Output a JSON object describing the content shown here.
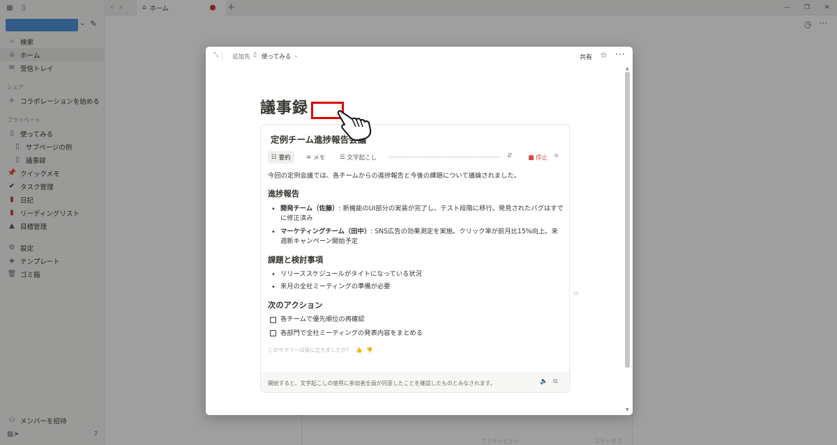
{
  "sidebar": {
    "search": "検索",
    "home": "ホーム",
    "inbox": "受信トレイ",
    "shared_section": "シェア",
    "start_collab": "コラボレーションを始める",
    "private_section": "プライベート",
    "pages": [
      "使ってみる",
      "サブページの例",
      "議事録",
      "クイックメモ",
      "タスク管理",
      "日記",
      "リーディングリスト",
      "目標管理"
    ],
    "settings": "設定",
    "templates": "テンプレート",
    "trash": "ゴミ箱",
    "invite": "メンバーを招待"
  },
  "tab": {
    "label": "ホーム"
  },
  "modal": {
    "add_to": "追加先",
    "page_name": "使ってみる",
    "share": "共有",
    "title": "議事録",
    "card_title": "定例チーム進捗報告会議",
    "tools": {
      "summary": "要約",
      "memo": "メモ",
      "transcript": "文字起こし",
      "stop": "停止"
    },
    "intro": "今回の定例会議では、各チームからの進捗報告と今後の課題について議論されました。",
    "sec1": "進捗報告",
    "item1_bold": "開発チーム（佐藤）",
    "item1_text": ": 新機能のUI部分の実装が完了し、テスト段階に移行。発見されたバグはすでに修正済み",
    "item2_bold": "マーケティングチーム（田中）",
    "item2_text": ": SNS広告の効果測定を実施。クリック率が前月比15%向上。来週新キャンペーン開始予定",
    "sec2": "課題と検討事項",
    "issues": [
      "リリーススケジュールがタイトになっている状況",
      "来月の全社ミーティングの準備が必要"
    ],
    "sec3": "次のアクション",
    "actions": [
      "各チームで優先順位の再確認",
      "各部門で全社ミーティングの発表内容をまとめる"
    ],
    "feedback": "このサマリーは役に立ちましたか？",
    "footer": "開始すると、文字起こしの使用に参加者全員が同意したことを確認したものとみなされます。"
  },
  "background": {
    "hint1": "アクティビティ",
    "hint2": "ステータス"
  }
}
